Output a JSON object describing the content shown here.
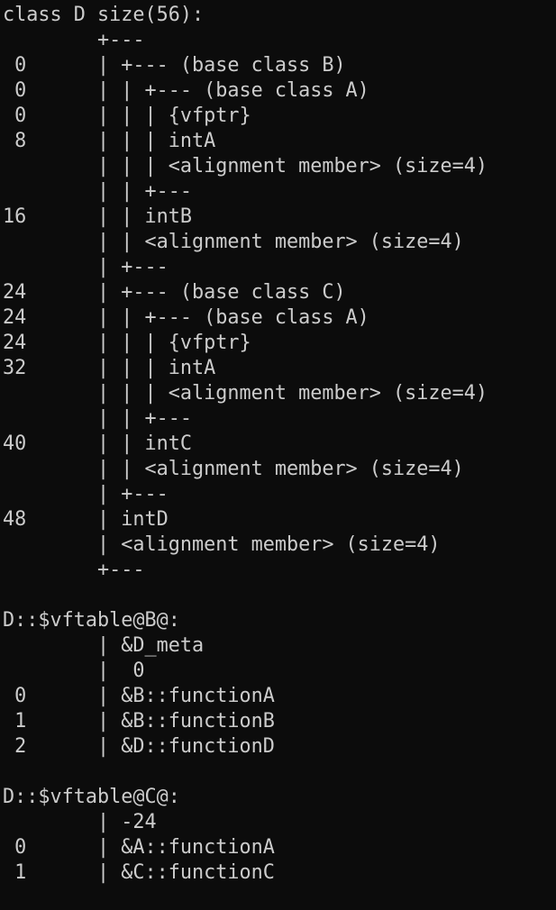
{
  "terminal": {
    "background": "#0c0c0c",
    "foreground": "#cccccc",
    "lines": [
      "class D size(56):",
      "        +---",
      " 0      | +--- (base class B)",
      " 0      | | +--- (base class A)",
      " 0      | | | {vfptr}",
      " 8      | | | intA",
      "        | | | <alignment member> (size=4)",
      "        | | +---",
      "16      | | intB",
      "        | | <alignment member> (size=4)",
      "        | +---",
      "24      | +--- (base class C)",
      "24      | | +--- (base class A)",
      "24      | | | {vfptr}",
      "32      | | | intA",
      "        | | | <alignment member> (size=4)",
      "        | | +---",
      "40      | | intC",
      "        | | <alignment member> (size=4)",
      "        | +---",
      "48      | intD",
      "        | <alignment member> (size=4)",
      "        +---",
      "",
      "D::$vftable@B@:",
      "        | &D_meta",
      "        |  0",
      " 0      | &B::functionA",
      " 1      | &B::functionB",
      " 2      | &D::functionD",
      "",
      "D::$vftable@C@:",
      "        | -24",
      " 0      | &A::functionA",
      " 1      | &C::functionC"
    ]
  }
}
